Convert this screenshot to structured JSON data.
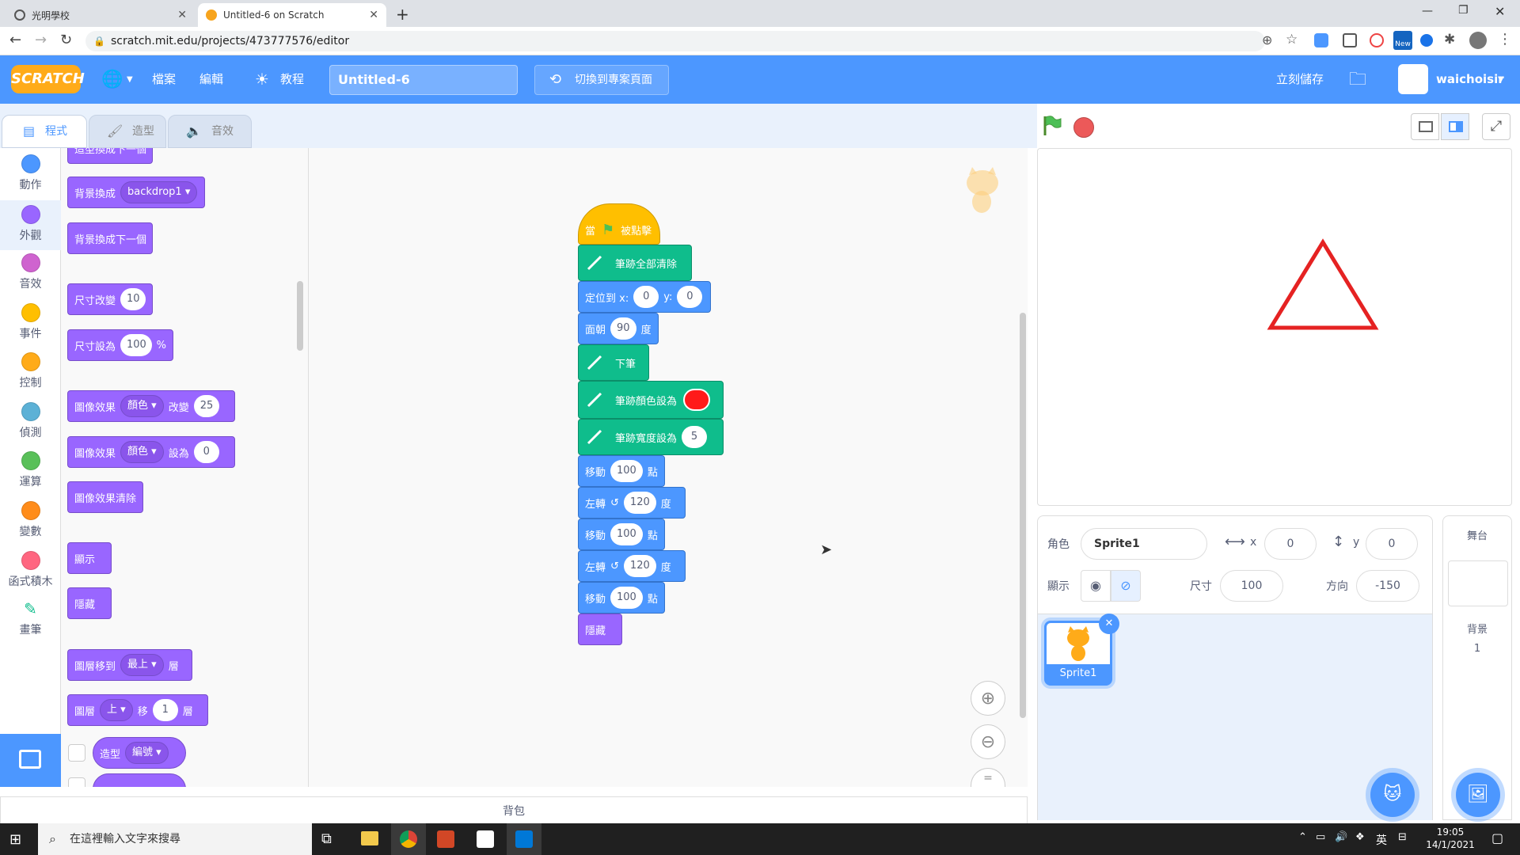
{
  "browser": {
    "tabs": [
      {
        "title": "光明學校",
        "active": false
      },
      {
        "title": "Untitled-6 on Scratch",
        "active": true
      }
    ],
    "new_tab": "+",
    "url": "scratch.mit.edu/projects/473777576/editor",
    "ext_badge": "New"
  },
  "menu": {
    "logo": "SCRATCH",
    "file": "檔案",
    "edit": "編輯",
    "tutorials": "教程",
    "project_title": "Untitled-6",
    "see_project": "切換到專案頁面",
    "save_now": "立刻儲存",
    "username": "waichoisir"
  },
  "editor_tabs": {
    "code": "程式",
    "costumes": "造型",
    "sounds": "音效"
  },
  "categories": [
    {
      "label": "動作",
      "color": "#4c97ff"
    },
    {
      "label": "外觀",
      "color": "#9966ff",
      "selected": true
    },
    {
      "label": "音效",
      "color": "#cf63cf"
    },
    {
      "label": "事件",
      "color": "#ffbf00"
    },
    {
      "label": "控制",
      "color": "#ffab19"
    },
    {
      "label": "偵測",
      "color": "#5cb1d6"
    },
    {
      "label": "運算",
      "color": "#59c059"
    },
    {
      "label": "變數",
      "color": "#ff8c1a"
    },
    {
      "label": "函式積木",
      "color": "#ff6680"
    },
    {
      "label": "畫筆",
      "color": "#0fbd8c"
    }
  ],
  "palette": {
    "top_cut": "造型換成下一個",
    "switch_backdrop": "背景換成",
    "backdrop_value": "backdrop1",
    "next_backdrop": "背景換成下一個",
    "change_size": "尺寸改變",
    "change_size_val": "10",
    "set_size": "尺寸設為",
    "set_size_val": "100",
    "set_size_unit": "%",
    "change_effect": "圖像效果",
    "effect_color": "顏色",
    "change_by": "改變",
    "change_effect_val": "25",
    "set_effect": "圖像效果",
    "set_effect_color": "顏色",
    "set_to": "設為",
    "set_effect_val": "0",
    "clear_effects": "圖像效果清除",
    "show": "顯示",
    "hide": "隱藏",
    "goto_layer": "圖層移到",
    "layer_front": "最上",
    "layer_unit": "層",
    "go_layer": "圖層",
    "layer_dir": "上",
    "layer_move": "移",
    "layer_val": "1",
    "layer_unit2": "層",
    "costume_rep": "造型",
    "costume_rep_dd": "編號"
  },
  "script": {
    "hat_when": "當",
    "hat_clicked": "被點擊",
    "pen_clear": "筆跡全部清除",
    "goto": "定位到 x:",
    "goto_x": "0",
    "goto_y_label": "y:",
    "goto_y": "0",
    "point": "面朝",
    "point_val": "90",
    "point_unit": "度",
    "pen_down": "下筆",
    "pen_color": "筆跡顏色設為",
    "pen_color_hex": "#ff1a1a",
    "pen_size": "筆跡寬度設為",
    "pen_size_val": "5",
    "move": "移動",
    "move_val": "100",
    "move_unit": "點",
    "turn": "左轉",
    "turn_val": "120",
    "turn_unit": "度",
    "hide": "隱藏"
  },
  "backpack": "背包",
  "sprite_info": {
    "sprite_label": "角色",
    "sprite_name": "Sprite1",
    "x_label": "x",
    "x": "0",
    "y_label": "y",
    "y": "0",
    "show_label": "顯示",
    "size_label": "尺寸",
    "size": "100",
    "direction_label": "方向",
    "direction": "-150"
  },
  "sprite_list": [
    {
      "name": "Sprite1"
    }
  ],
  "stage_pane": {
    "title": "舞台",
    "backdrops_label": "背景",
    "backdrops_count": "1"
  },
  "taskbar": {
    "search_placeholder": "在這裡輸入文字來搜尋",
    "time": "19:05",
    "date": "14/1/2021",
    "ime": "英"
  }
}
